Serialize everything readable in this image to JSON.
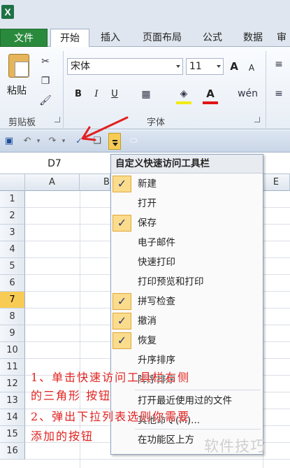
{
  "tabs": [
    "文件",
    "开始",
    "插入",
    "页面布局",
    "公式",
    "数据",
    "审"
  ],
  "clipboard": {
    "paste_label": "粘贴",
    "group_label": "剪贴板"
  },
  "font_group": {
    "font_name": "宋体",
    "font_size": "11",
    "group_label": "字体",
    "bold": "B",
    "italic": "I",
    "underline": "U",
    "grow": "A",
    "shrink": "A"
  },
  "accent_colors": {
    "file_tab": "#2a8a3c",
    "highlight": "#f8cc54",
    "annotation": "#e0211f"
  },
  "name_box": "D7",
  "columns": [
    "A",
    "B",
    "E"
  ],
  "rows": [
    "1",
    "2",
    "3",
    "4",
    "5",
    "6",
    "7",
    "8",
    "9",
    "10",
    "11",
    "12",
    "13",
    "14",
    "15",
    "16"
  ],
  "selected_row": "7",
  "menu": {
    "title": "自定义快速访问工具栏",
    "items": [
      {
        "label": "新建",
        "checked": true
      },
      {
        "label": "打开",
        "checked": false
      },
      {
        "label": "保存",
        "checked": true
      },
      {
        "label": "电子邮件",
        "checked": false
      },
      {
        "label": "快速打印",
        "checked": false
      },
      {
        "label": "打印预览和打印",
        "checked": false
      },
      {
        "label": "拼写检查",
        "checked": true
      },
      {
        "label": "撤消",
        "checked": true
      },
      {
        "label": "恢复",
        "checked": true
      },
      {
        "label": "升序排序",
        "checked": false
      },
      {
        "label": "降序排序",
        "checked": false
      },
      {
        "label": "打开最近使用过的文件",
        "checked": false
      },
      {
        "label": "其他命令(M)...",
        "checked": false
      },
      {
        "label": "在功能区上方",
        "checked": false
      }
    ]
  },
  "annotation": {
    "line1": "1、单击快速访问工具栏右侧",
    "line2": "的三角形 按钮",
    "line3": "2、弹出下拉列表选则你需要",
    "line4": "添加的按钮"
  },
  "watermark": "软件技巧"
}
